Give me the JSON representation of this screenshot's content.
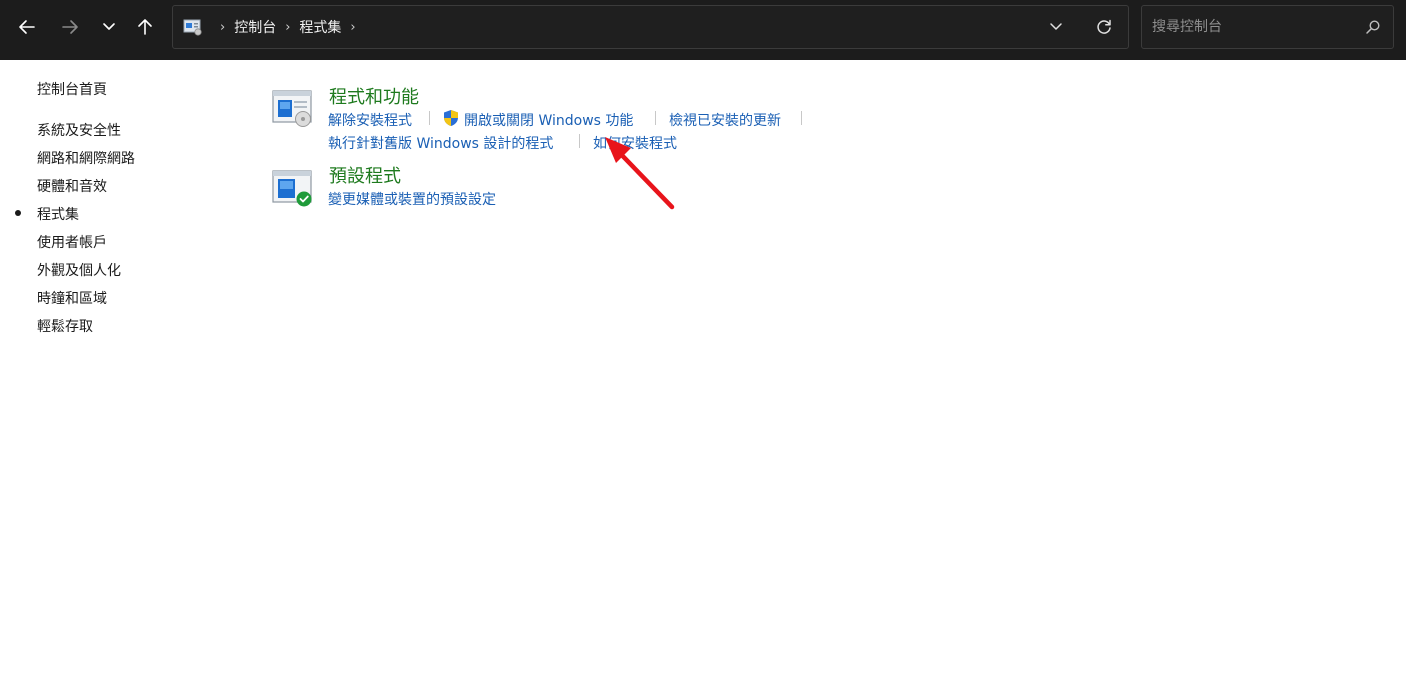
{
  "breadcrumb": {
    "items": [
      "控制台",
      "程式集"
    ]
  },
  "search": {
    "placeholder": "搜尋控制台"
  },
  "sidebar": {
    "items": [
      {
        "label": "控制台首頁",
        "selected": false
      },
      {
        "label": "系統及安全性",
        "selected": false
      },
      {
        "label": "網路和網際網路",
        "selected": false
      },
      {
        "label": "硬體和音效",
        "selected": false
      },
      {
        "label": "程式集",
        "selected": true
      },
      {
        "label": "使用者帳戶",
        "selected": false
      },
      {
        "label": "外觀及個人化",
        "selected": false
      },
      {
        "label": "時鐘和區域",
        "selected": false
      },
      {
        "label": "輕鬆存取",
        "selected": false
      }
    ]
  },
  "main": {
    "sections": [
      {
        "title": "程式和功能",
        "icon": "programs-features-icon",
        "links": [
          "解除安裝程式",
          "開啟或關閉 Windows 功能",
          "檢視已安裝的更新",
          "執行針對舊版 Windows 設計的程式",
          "如何安裝程式"
        ]
      },
      {
        "title": "預設程式",
        "icon": "default-programs-icon",
        "links": [
          "變更媒體或裝置的預設設定"
        ]
      }
    ]
  },
  "colors": {
    "titlebar": "#1c1c1c",
    "section_title": "#1e7a1e",
    "link": "#1a5fb4",
    "annotation_arrow": "#e8141b"
  }
}
